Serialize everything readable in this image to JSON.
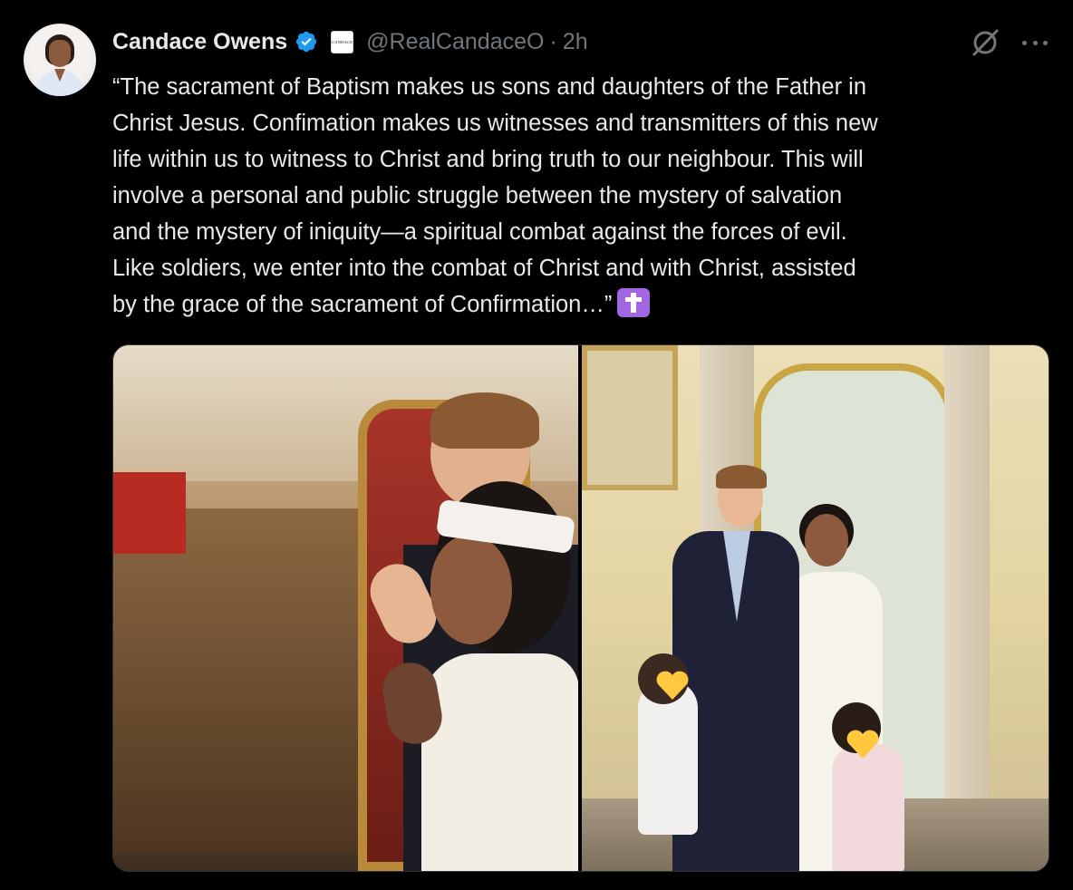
{
  "author": {
    "name": "Candace Owens",
    "handle": "@RealCandaceO",
    "separator": "·",
    "time": "2h",
    "affiliate_badge_text": "CANDACE"
  },
  "tweet": {
    "text": "“The sacrament of Baptism makes us sons and daughters of the Father in\nChrist Jesus. Confimation makes us witnesses and transmitters of this new\nlife within us to witness to Christ and bring truth to our neighbour. This will\ninvolve a personal and public struggle between the mystery of salvation\nand the mystery of iniquity—a spiritual combat against the forces of evil.\nLike soldiers, we enter into the combat of Christ and with Christ, assisted\nby the grace of the sacrament of Confirmation…”"
  },
  "icons": {
    "avatar": "avatar",
    "verified": "verified-badge-icon",
    "affiliate": "affiliate-badge-icon",
    "grok": "grok-icon",
    "more": "more-options-icon",
    "emoji": "latin-cross-emoji-icon"
  },
  "colors": {
    "background": "#000000",
    "primary_text": "#e7e9ea",
    "secondary_text": "#71767b",
    "verified_blue": "#1d9bf0",
    "emoji_purple": "#a366e3"
  }
}
